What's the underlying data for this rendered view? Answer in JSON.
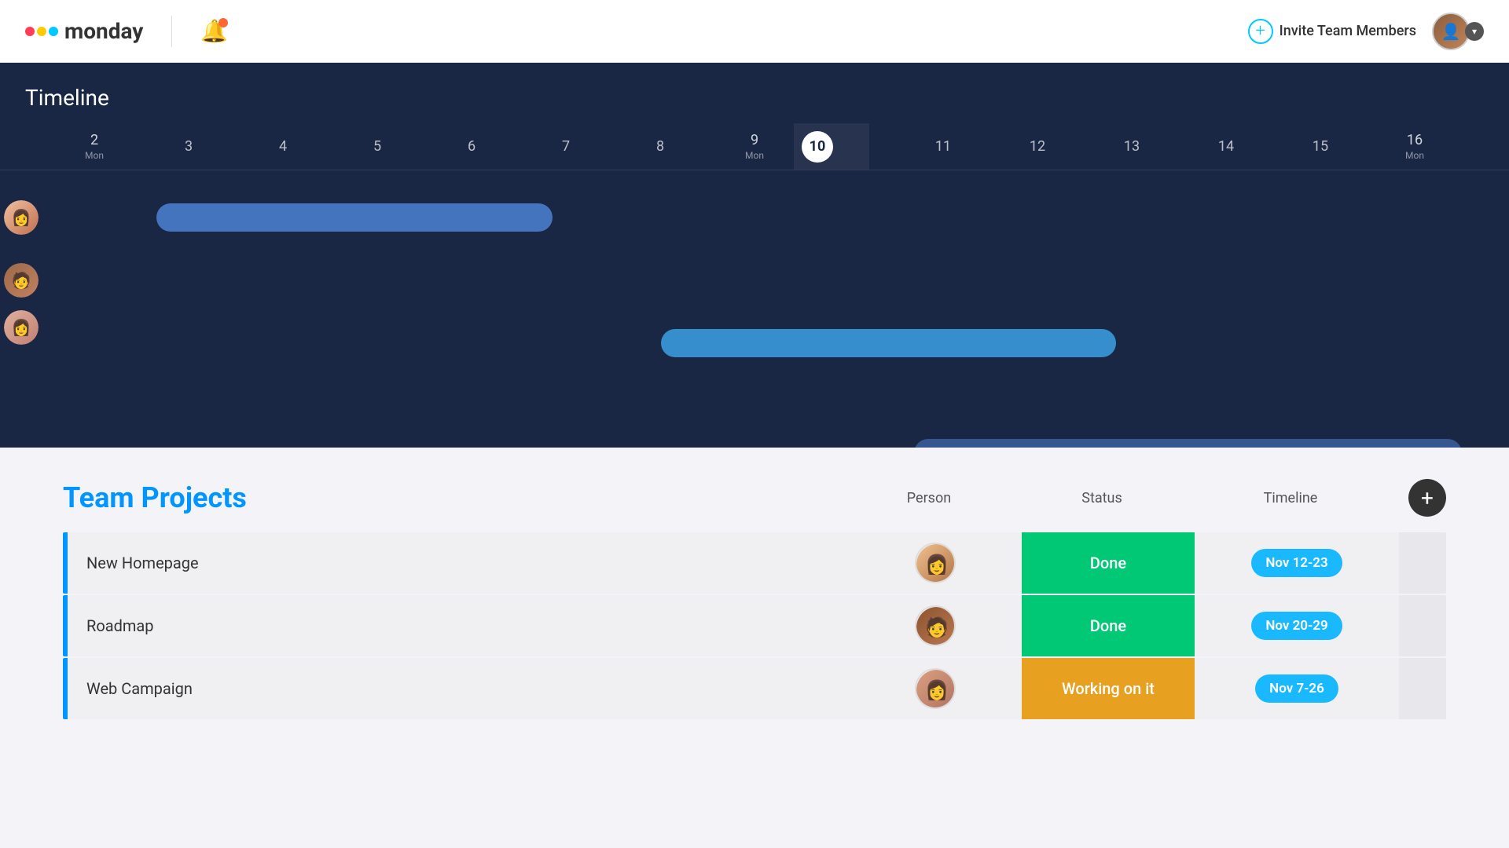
{
  "header": {
    "logo_word": "monday",
    "invite_label": "Invite Team Members",
    "user_chevron": "▾"
  },
  "timeline": {
    "title": "Timeline",
    "dates": [
      {
        "num": "2",
        "day": "Mon",
        "is_today": false
      },
      {
        "num": "3",
        "day": "",
        "is_today": false
      },
      {
        "num": "4",
        "day": "",
        "is_today": false
      },
      {
        "num": "5",
        "day": "",
        "is_today": false
      },
      {
        "num": "6",
        "day": "",
        "is_today": false
      },
      {
        "num": "7",
        "day": "",
        "is_today": false
      },
      {
        "num": "8",
        "day": "",
        "is_today": false
      },
      {
        "num": "9",
        "day": "Mon",
        "is_today": false
      },
      {
        "num": "10",
        "day": "",
        "is_today": true
      },
      {
        "num": "11",
        "day": "",
        "is_today": false
      },
      {
        "num": "12",
        "day": "",
        "is_today": false
      },
      {
        "num": "13",
        "day": "",
        "is_today": false
      },
      {
        "num": "14",
        "day": "",
        "is_today": false
      },
      {
        "num": "15",
        "day": "",
        "is_today": false
      },
      {
        "num": "16",
        "day": "Mon",
        "is_today": false
      }
    ]
  },
  "table": {
    "title": "Team Projects",
    "col_person": "Person",
    "col_status": "Status",
    "col_timeline": "Timeline",
    "add_icon": "+",
    "rows": [
      {
        "name": "New Homepage",
        "person_avatar": "av-1",
        "status": "Done",
        "status_class": "status-done",
        "timeline": "Nov 12-23"
      },
      {
        "name": "Roadmap",
        "person_avatar": "av-2",
        "status": "Done",
        "status_class": "status-done",
        "timeline": "Nov 20-29"
      },
      {
        "name": "Web Campaign",
        "person_avatar": "av-3",
        "status": "Working on it",
        "status_class": "status-working",
        "timeline": "Nov 7-26"
      }
    ]
  }
}
